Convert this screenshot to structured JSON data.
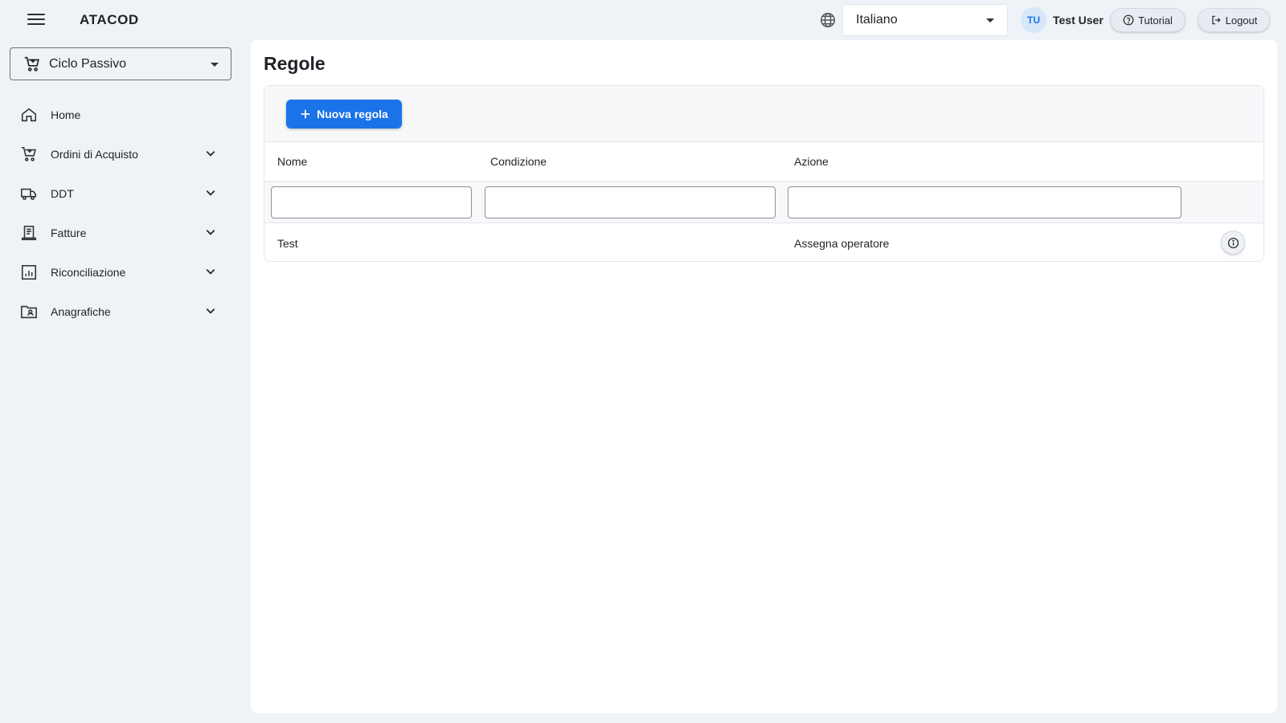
{
  "app": {
    "title": "ATACOD"
  },
  "header": {
    "language": "Italiano",
    "user_initials": "TU",
    "user_name": "Test User",
    "tutorial_label": "Tutorial",
    "logout_label": "Logout"
  },
  "sidebar": {
    "module": "Ciclo Passivo",
    "items": [
      {
        "label": "Home",
        "icon": "home-icon",
        "expandable": false
      },
      {
        "label": "Ordini di Acquisto",
        "icon": "cart-icon",
        "expandable": true
      },
      {
        "label": "DDT",
        "icon": "truck-icon",
        "expandable": true
      },
      {
        "label": "Fatture",
        "icon": "receipt-icon",
        "expandable": true
      },
      {
        "label": "Riconciliazione",
        "icon": "chart-icon",
        "expandable": true
      },
      {
        "label": "Anagrafiche",
        "icon": "contact-folder-icon",
        "expandable": true
      }
    ]
  },
  "main": {
    "title": "Regole",
    "new_button": "Nuova regola",
    "columns": [
      "Nome",
      "Condizione",
      "Azione"
    ],
    "filters": [
      "",
      "",
      ""
    ],
    "rows": [
      {
        "nome": "Test",
        "condizione": "",
        "azione": "Assegna operatore"
      }
    ]
  },
  "colors": {
    "accent": "#1a73e8",
    "background": "#eff2f6",
    "panel": "#ffffff"
  }
}
